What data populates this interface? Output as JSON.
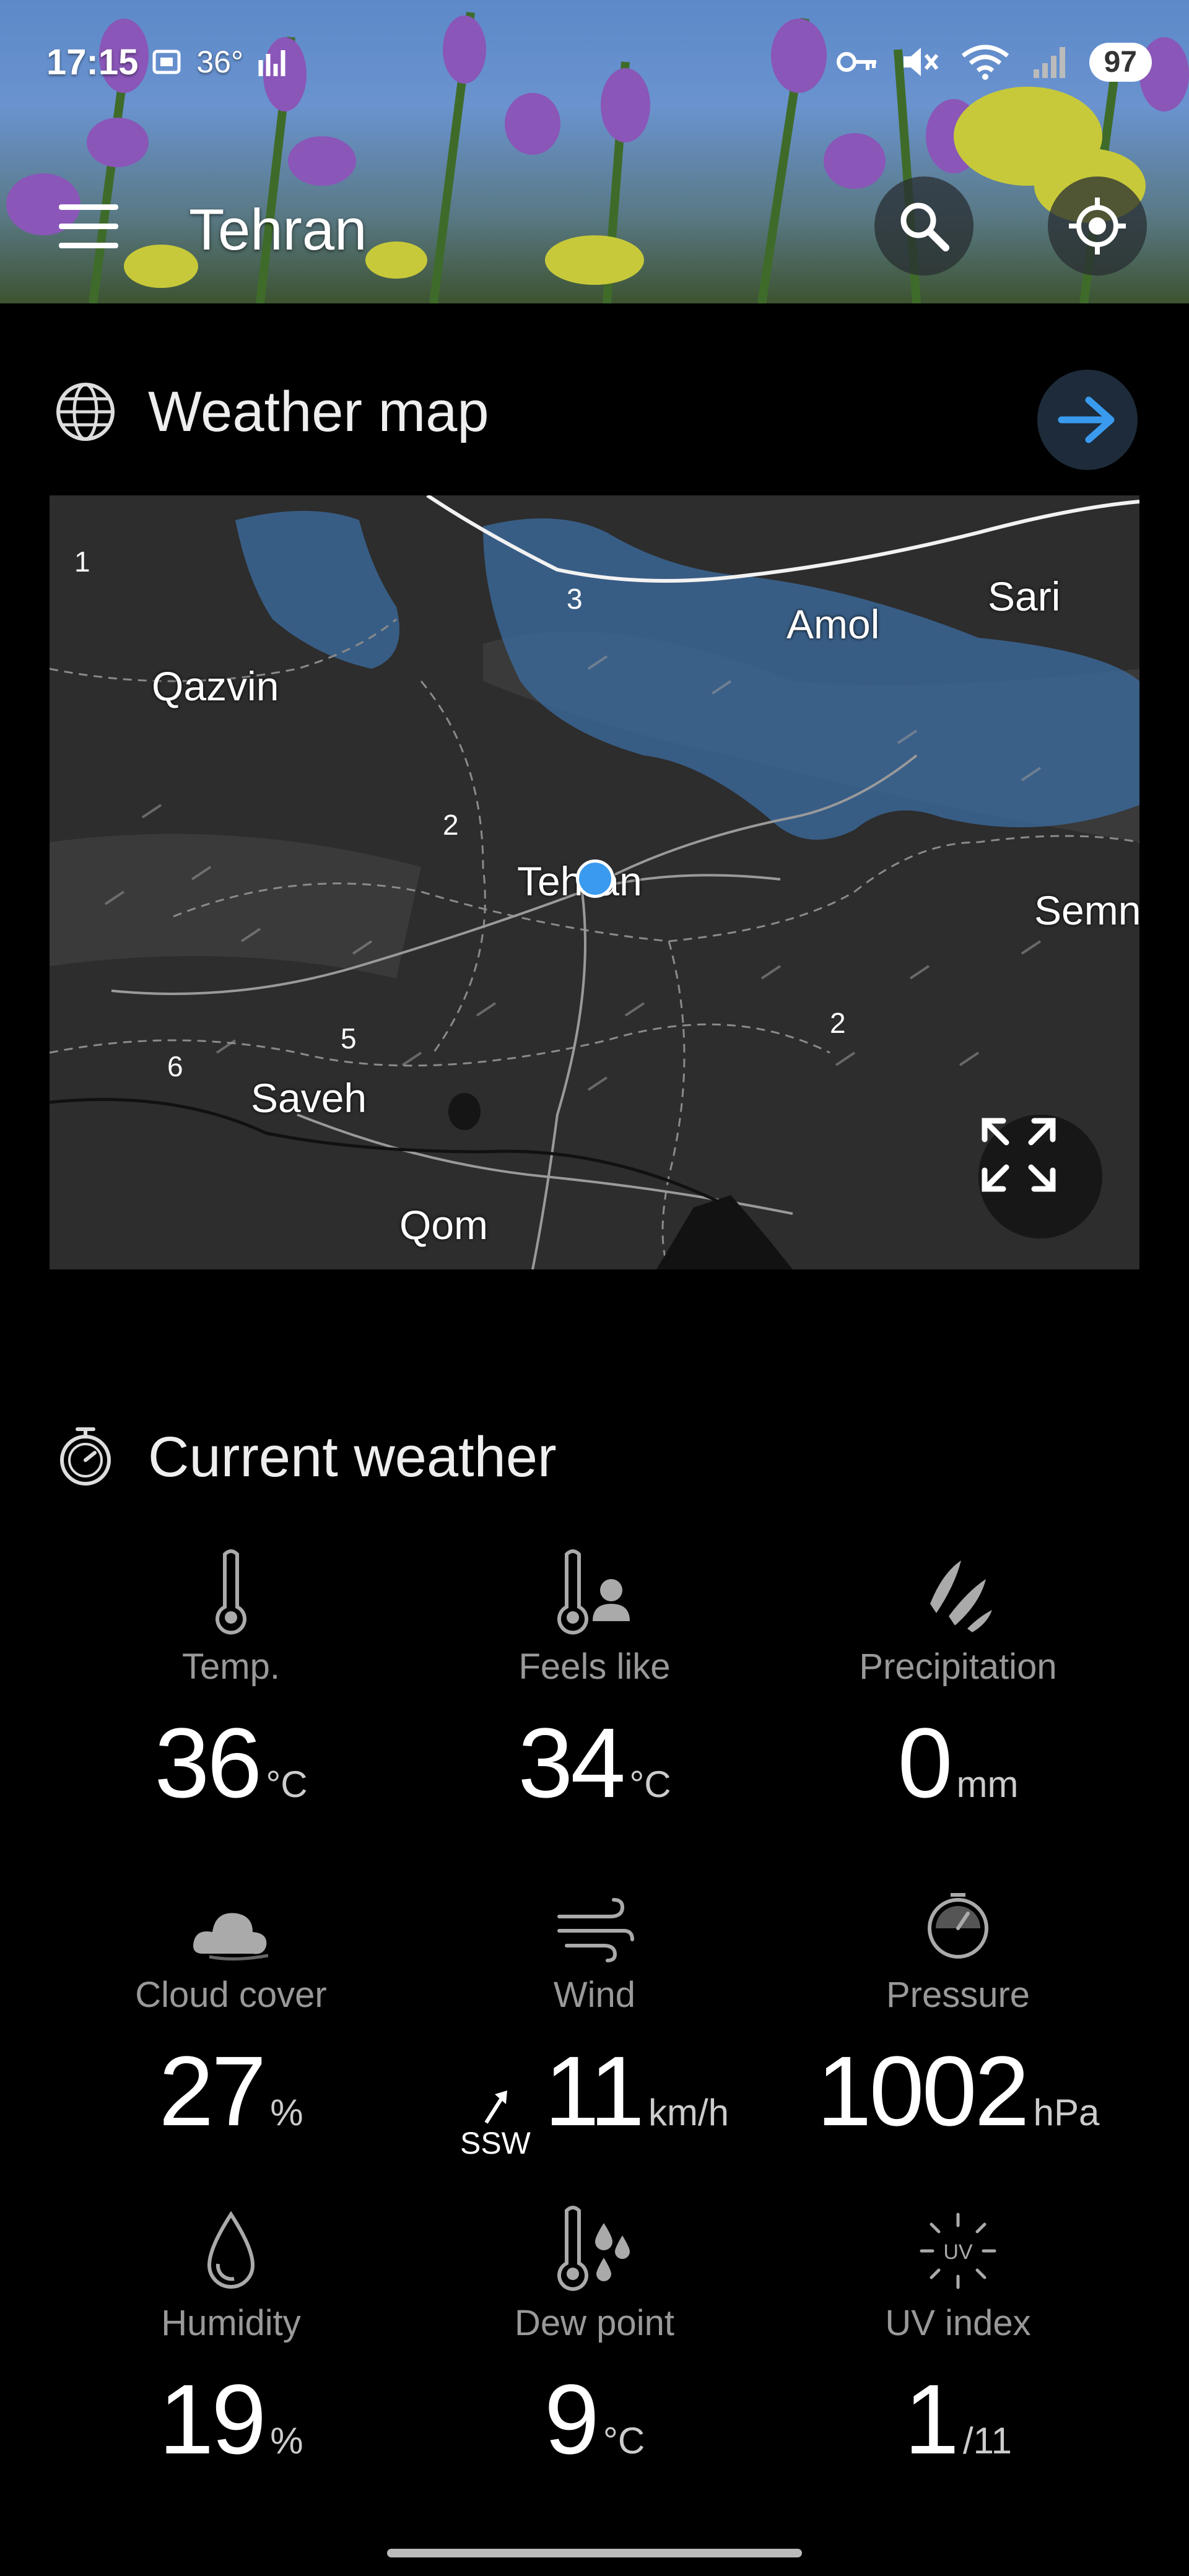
{
  "status_bar": {
    "time": "17:15",
    "temp": "36°",
    "battery": "97"
  },
  "header": {
    "city": "Tehran",
    "icons": [
      "menu-icon",
      "search-icon",
      "locate-icon"
    ]
  },
  "weather_map": {
    "title": "Weather map",
    "cities": [
      "Amol",
      "Sari",
      "Qazvin",
      "Tehran",
      "Semn",
      "Saveh",
      "Qom"
    ],
    "numbers": [
      "1",
      "3",
      "2",
      "2",
      "5",
      "6"
    ]
  },
  "current_weather": {
    "title": "Current weather",
    "metrics": [
      {
        "label": "Temp.",
        "value": "36",
        "unit": "°C",
        "icon": "thermometer-icon"
      },
      {
        "label": "Feels like",
        "value": "34",
        "unit": "°C",
        "icon": "feels-like-icon"
      },
      {
        "label": "Precipitation",
        "value": "0",
        "unit": "mm",
        "icon": "precipitation-icon"
      },
      {
        "label": "Cloud cover",
        "value": "27",
        "unit": "%",
        "icon": "cloud-icon"
      },
      {
        "label": "Wind",
        "value": "11",
        "unit": "km/h",
        "direction": "SSW",
        "icon": "wind-icon"
      },
      {
        "label": "Pressure",
        "value": "1002",
        "unit": "hPa",
        "icon": "pressure-icon"
      },
      {
        "label": "Humidity",
        "value": "19",
        "unit": "%",
        "icon": "humidity-icon"
      },
      {
        "label": "Dew point",
        "value": "9",
        "unit": "°C",
        "icon": "dew-point-icon"
      },
      {
        "label": "UV index",
        "value": "1",
        "unit": "/11",
        "icon": "uv-icon"
      }
    ]
  },
  "colors": {
    "accent": "#3a9aee",
    "background": "#000000",
    "label": "#999999"
  }
}
